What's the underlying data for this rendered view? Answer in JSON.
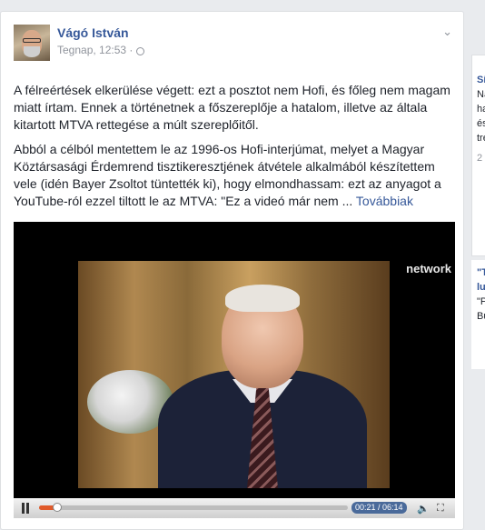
{
  "post": {
    "author": "Vágó István",
    "timestamp": "Tegnap, 12:53 ·",
    "paragraph1": "A félreértések elkerülése végett: ezt a posztot nem Hofi, és főleg nem magam miatt írtam. Ennek a történetnek a főszereplője a hatalom, illetve az általa kitartott MTVA rettegése a múlt szereplőitől.",
    "paragraph2": "Abból a célból mentettem le az 1996-os Hofi-interjúmat, melyet a Magyar Köztársasági Érdemrend tisztikeresztjének átvétele alkalmából készítettem vele (idén Bayer Zsoltot tüntették ki), hogy elmondhassam: ezt az anyagot a YouTube-ról ezzel tiltott le az MTVA: \"Ez a videó már nem ...",
    "more_link": "Továbbiak"
  },
  "video": {
    "watermark": "network",
    "time": "00:21 / 06:14",
    "progress": 0.06
  },
  "sidebar": {
    "lines": [
      {
        "text": "Sí",
        "style": "b"
      },
      {
        "text": "Na",
        "style": ""
      },
      {
        "text": "ha",
        "style": ""
      },
      {
        "text": "és",
        "style": ""
      },
      {
        "text": "tre",
        "style": ""
      },
      {
        "text": "2",
        "style": "g"
      },
      {
        "text": "\"T",
        "style": "b"
      },
      {
        "text": "lu",
        "style": "b"
      },
      {
        "text": "\"P",
        "style": ""
      },
      {
        "text": "Bu",
        "style": ""
      }
    ]
  },
  "colors": {
    "link": "#365899",
    "text": "#1d2129",
    "muted": "#90949c",
    "progress": "#e05a2a"
  }
}
